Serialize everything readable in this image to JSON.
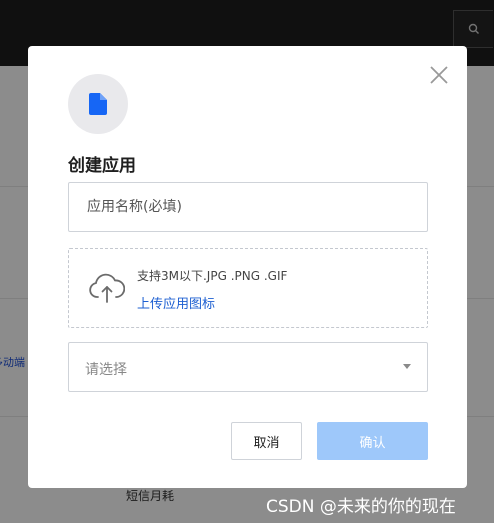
{
  "background": {
    "left_text": "多动端",
    "bottom_text": "短信月耗"
  },
  "watermark": "CSDN @未来的你的现在",
  "modal": {
    "title": "创建应用",
    "name_input": {
      "placeholder": "应用名称(必填)",
      "value": ""
    },
    "upload": {
      "hint": "支持3M以下.JPG .PNG .GIF",
      "link_label": "上传应用图标"
    },
    "select": {
      "placeholder": "请选择"
    },
    "buttons": {
      "cancel": "取消",
      "confirm": "确认"
    }
  },
  "colors": {
    "primary_link": "#1d5fd1",
    "confirm_disabled": "#9ec8fa",
    "app_icon": "#1666f5"
  },
  "icons": [
    "search-icon",
    "close-icon",
    "file-icon",
    "cloud-upload-icon",
    "chevron-down-icon"
  ]
}
